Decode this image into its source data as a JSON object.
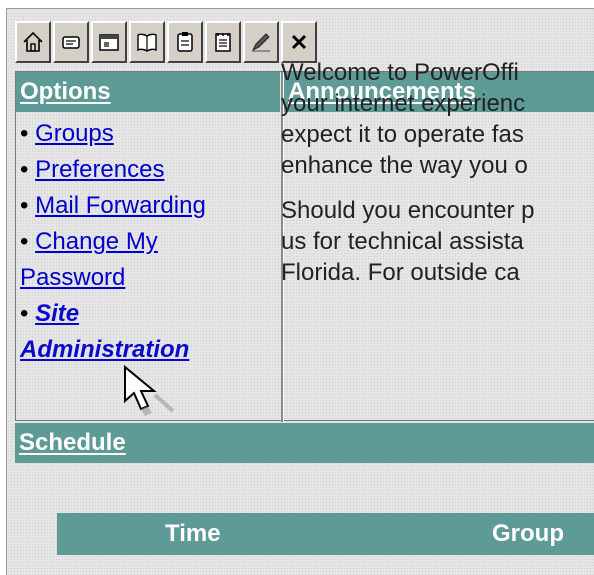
{
  "toolbar": {
    "buttons": [
      {
        "icon": "home-icon"
      },
      {
        "icon": "message-icon"
      },
      {
        "icon": "calendar-icon"
      },
      {
        "icon": "book-icon"
      },
      {
        "icon": "clipboard-icon"
      },
      {
        "icon": "notepad-icon"
      },
      {
        "icon": "pencil-icon"
      },
      {
        "icon": "close-icon"
      }
    ]
  },
  "options": {
    "title": "Options",
    "items": {
      "groups": "Groups",
      "preferences": "Preferences",
      "mail_forwarding": "Mail Forwarding",
      "change_password_1": "Change My",
      "change_password_2": "Password",
      "site_admin_1": "Site",
      "site_admin_2": "Administration"
    },
    "bullet": "•"
  },
  "announcements": {
    "title": "Announcements",
    "lines": [
      "Welcome to PowerOffi",
      "your internet experienc",
      "expect it to operate fas",
      "enhance the way you o",
      "Should you encounter p",
      "us for technical assista",
      "Florida. For outside ca"
    ]
  },
  "schedule": {
    "title": "Schedule",
    "col_time": "Time",
    "col_group": "Group"
  },
  "colors": {
    "header_bg": "#5e9b96",
    "link": "#0000cc",
    "page_bg": "#e6e6e6"
  }
}
